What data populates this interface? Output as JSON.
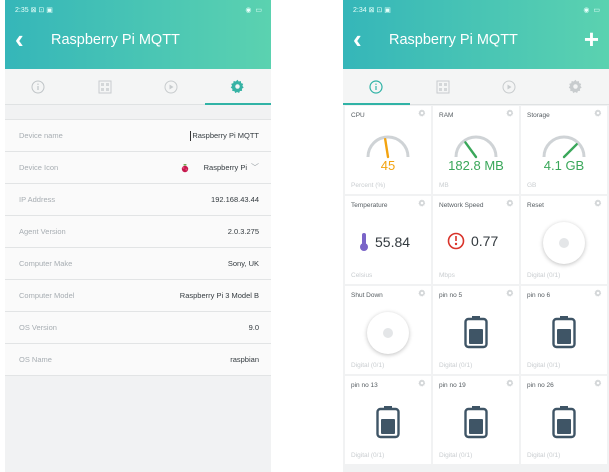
{
  "left": {
    "status": {
      "time": "2:35",
      "icons_left": "⊠ ⊡ ▣",
      "icons_right": "◉ ▭"
    },
    "title": "Raspberry Pi MQTT",
    "tabs": [
      "info",
      "grid",
      "play",
      "settings"
    ],
    "active_tab": "settings",
    "rows": [
      {
        "label": "Device name",
        "value": "Raspberry Pi MQTT"
      },
      {
        "label": "Device Icon",
        "value": "Raspberry Pi"
      },
      {
        "label": "IP Address",
        "value": "192.168.43.44"
      },
      {
        "label": "Agent Version",
        "value": "2.0.3.275"
      },
      {
        "label": "Computer Make",
        "value": "Sony, UK"
      },
      {
        "label": "Computer Model",
        "value": "Raspberry Pi 3 Model B"
      },
      {
        "label": "OS Version",
        "value": "9.0"
      },
      {
        "label": "OS Name",
        "value": "raspbian"
      }
    ]
  },
  "right": {
    "status": {
      "time": "2:34",
      "icons_left": "⊠ ⊡ ▣",
      "icons_right": "◉ ▭"
    },
    "title": "Raspberry Pi MQTT",
    "add_label": "+",
    "active_tab": "info",
    "cards": [
      {
        "name": "CPU",
        "value": "45",
        "unit": "Percent (%)",
        "gauge_level": 0.45,
        "kind": "gauge",
        "color": "#f3a30f"
      },
      {
        "name": "RAM",
        "value": "182.8 MB",
        "unit": "MB",
        "gauge_level": 0.3,
        "kind": "gauge",
        "color": "#3aa75a"
      },
      {
        "name": "Storage",
        "value": "4.1 GB",
        "unit": "GB",
        "gauge_level": 0.75,
        "kind": "gauge",
        "color": "#3aa75a"
      },
      {
        "name": "Temperature",
        "value": "55.84",
        "unit": "Celsius",
        "kind": "temp"
      },
      {
        "name": "Network Speed",
        "value": "0.77",
        "unit": "Mbps",
        "kind": "speed"
      },
      {
        "name": "Reset",
        "unit": "Digital (0/1)",
        "kind": "knob"
      },
      {
        "name": "Shut Down",
        "unit": "Digital (0/1)",
        "kind": "knob"
      },
      {
        "name": "pin no 5",
        "unit": "Digital (0/1)",
        "kind": "batt"
      },
      {
        "name": "pin no 6",
        "unit": "Digital (0/1)",
        "kind": "batt"
      },
      {
        "name": "pin no 13",
        "unit": "Digital (0/1)",
        "kind": "batt"
      },
      {
        "name": "pin no 19",
        "unit": "Digital (0/1)",
        "kind": "batt"
      },
      {
        "name": "pin no 26",
        "unit": "Digital (0/1)",
        "kind": "batt"
      }
    ]
  },
  "colors": {
    "header_start": "#35b6b9",
    "header_end": "#5bd2b0",
    "accent": "#30b3a6",
    "temp_icon": "#7a64c8",
    "speed_icon": "#d9332a"
  }
}
